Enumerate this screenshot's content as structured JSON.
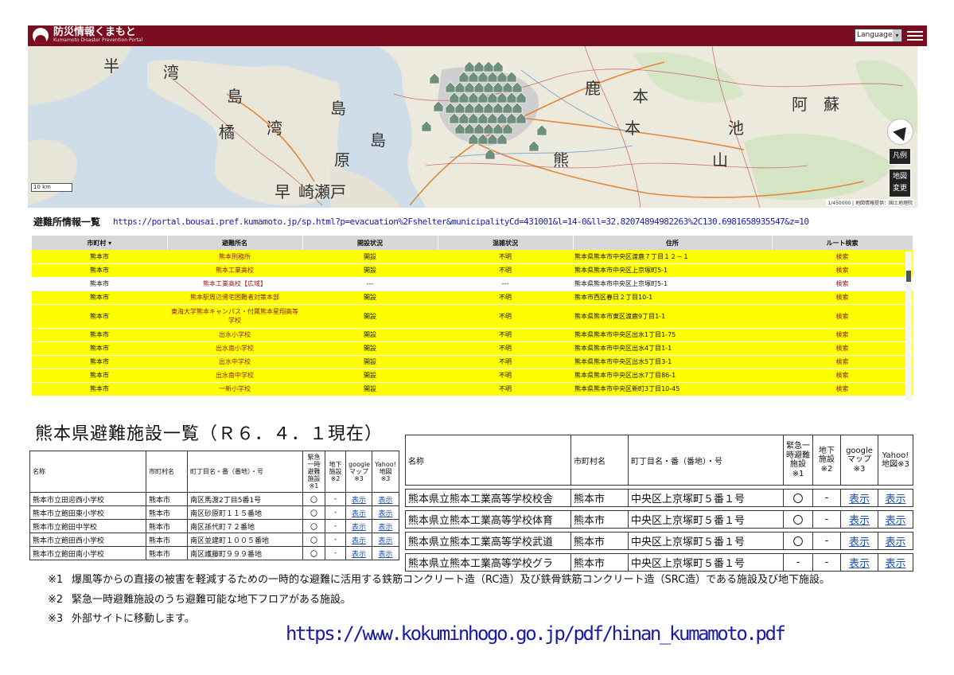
{
  "header": {
    "brand": "防災情報くまもと",
    "brand_sub": "Kumamoto Disaster Prevention Portal",
    "language": "Language",
    "accent": "#7a0d1f"
  },
  "map": {
    "place_labels": [
      "半",
      "湾",
      "島",
      "橘",
      "湾",
      "島",
      "原",
      "島",
      "早",
      "崎",
      "瀬",
      "戸",
      "熊",
      "本",
      "山",
      "鹿",
      "本",
      "池",
      "阿",
      "蘇"
    ],
    "scale": "10 km",
    "attribution": "1/450000 | 地図情報提供：国土地理院",
    "legend_btn": "凡例",
    "change_btn": "地図\n変更",
    "icons": [
      "compass-icon",
      "shelter-marker-icon"
    ]
  },
  "list_section": {
    "title": "避難所情報一覧",
    "url": "https://portal.bousai.pref.kumamoto.jp/sp.html?p=evacuation%2Fshelter&municipalityCd=431001&l=14-0&ll=32.82074894982263%2C130.6981658935547&z=10"
  },
  "shelter_table": {
    "columns": [
      "市町村",
      "避難所名",
      "開設状況",
      "混雑状況",
      "住所",
      "ルート検索"
    ],
    "rows": [
      {
        "city": "熊本市",
        "name": "熊本刑務所",
        "open": "開設",
        "crowd": "不明",
        "addr": "熊本県熊本市中央区渡鹿７丁目１２－１",
        "route": "検索",
        "hl": true
      },
      {
        "city": "熊本市",
        "name": "熊本工業高校",
        "open": "開設",
        "crowd": "不明",
        "addr": "熊本県熊本市中央区上京塚町5-1",
        "route": "検索",
        "hl": true
      },
      {
        "city": "熊本市",
        "name": "熊本工業高校【広域】",
        "open": "---",
        "crowd": "---",
        "addr": "熊本県熊本市中央区上京塚町5-1",
        "route": "検索",
        "hl": false
      },
      {
        "city": "熊本市",
        "name": "熊本駅周辺帰宅困難者対策本部",
        "open": "開設",
        "crowd": "不明",
        "addr": "熊本市西区春日２丁目10-1",
        "route": "検索",
        "hl": true
      },
      {
        "city": "熊本市",
        "name": "東海大学熊本キャンパス・付属熊本星翔高等学校",
        "open": "開設",
        "crowd": "不明",
        "addr": "熊本県熊本市東区渡鹿9丁目1-1",
        "route": "検索",
        "hl": true,
        "tall": true
      },
      {
        "city": "熊本市",
        "name": "出水小学校",
        "open": "開設",
        "crowd": "不明",
        "addr": "熊本県熊本市中央区出水1丁目1-75",
        "route": "検索",
        "hl": true
      },
      {
        "city": "熊本市",
        "name": "出水南小学校",
        "open": "開設",
        "crowd": "不明",
        "addr": "熊本県熊本市中央区出水4丁目1-1",
        "route": "検索",
        "hl": true
      },
      {
        "city": "熊本市",
        "name": "出水中学校",
        "open": "開設",
        "crowd": "不明",
        "addr": "熊本県熊本市中央区出水5丁目3-1",
        "route": "検索",
        "hl": true
      },
      {
        "city": "熊本市",
        "name": "出水南中学校",
        "open": "開設",
        "crowd": "不明",
        "addr": "熊本県熊本市中央区出水7丁目86-1",
        "route": "検索",
        "hl": true
      },
      {
        "city": "熊本市",
        "name": "一新小学校",
        "open": "開設",
        "crowd": "不明",
        "addr": "熊本県熊本市中央区新町3丁目10-45",
        "route": "検索",
        "hl": true
      }
    ]
  },
  "facility_title": "熊本県避難施設一覧（Ｒ６．４．１現在）",
  "facility_table_left": {
    "headers": [
      "名称",
      "市町村名",
      "町丁目名・番（番地）・号",
      "緊急一時避難施設※1",
      "地下施設※2",
      "googleマップ※3",
      "Yahoo!地図※3"
    ],
    "rows": [
      [
        "熊本市立田迎西小学校",
        "熊本市",
        "南区馬渡2丁目5番1号",
        "〇",
        "-",
        "表示",
        "表示"
      ],
      [
        "熊本市立飽田東小学校",
        "熊本市",
        "南区砂原町１１５番地",
        "〇",
        "-",
        "表示",
        "表示"
      ],
      [
        "熊本市立飽田中学校",
        "熊本市",
        "南区孫代町７２番地",
        "〇",
        "-",
        "表示",
        "表示"
      ],
      [
        "熊本市立飽田西小学校",
        "熊本市",
        "南区並建町１００５番地",
        "〇",
        "-",
        "表示",
        "表示"
      ],
      [
        "熊本市立飽田南小学校",
        "熊本市",
        "南区護藤町９９９番地",
        "〇",
        "-",
        "表示",
        "表示"
      ]
    ]
  },
  "facility_table_right": {
    "headers": [
      "名称",
      "市町村名",
      "町丁目名・番（番地）・号",
      "緊急一時避難施設※1",
      "地下施設※2",
      "googleマップ※3",
      "Yahoo!地図※3"
    ],
    "rows": [
      [
        "熊本県立熊本工業高等学校校舎",
        "熊本市",
        "中央区上京塚町５番１号",
        "〇",
        "-",
        "表示",
        "表示"
      ],
      [
        "熊本県立熊本工業高等学校体育",
        "熊本市",
        "中央区上京塚町５番１号",
        "〇",
        "-",
        "表示",
        "表示"
      ],
      [
        "熊本県立熊本工業高等学校武道",
        "熊本市",
        "中央区上京塚町５番１号",
        "〇",
        "-",
        "表示",
        "表示"
      ],
      [
        "熊本県立熊本工業高等学校グラ",
        "熊本市",
        "中央区上京塚町５番１号",
        "-",
        "-",
        "表示",
        "表示"
      ]
    ]
  },
  "notes": [
    {
      "mark": "※1",
      "text": "爆風等からの直接の被害を軽減するための一時的な避難に活用する鉄筋コンクリート造（RC造）及び鉄骨鉄筋コンクリート造（SRC造）である施設及び地下施設。"
    },
    {
      "mark": "※2",
      "text": "緊急一時避難施設のうち避難可能な地下フロアがある施設。"
    },
    {
      "mark": "※3",
      "text": "外部サイトに移動します。"
    }
  ],
  "bottom_url": "https://www.kokuminhogo.go.jp/pdf/hinan_kumamoto.pdf",
  "colors": {
    "highlight": "#ffff00",
    "link": "#1a4fb4",
    "route": "#8b1a1a",
    "url": "#1a1aa6"
  }
}
